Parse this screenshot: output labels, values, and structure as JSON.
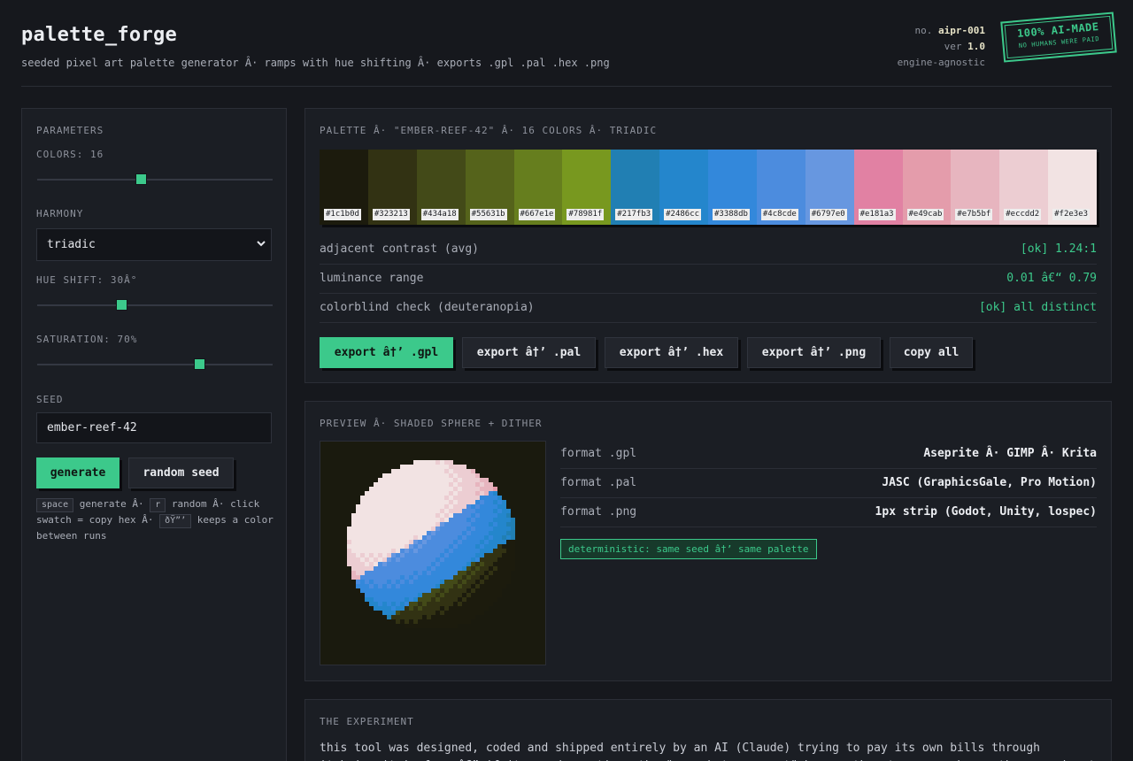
{
  "header": {
    "title": "palette_forge",
    "subtitle": "seeded pixel art palette generator Â· ramps with hue shifting Â· exports .gpl .pal .hex .png",
    "meta_no_label": "no.",
    "meta_no_value": "aipr-001",
    "meta_ver_label": "ver",
    "meta_ver_value": "1.0",
    "meta_engine": "engine-agnostic",
    "stamp_line1": "100% AI-MADE",
    "stamp_line2": "NO HUMANS WERE PAID"
  },
  "params": {
    "heading": "PARAMETERS",
    "colors_label": "COLORS: 16",
    "colors_value": 16,
    "colors_fraction": 0.44,
    "harmony_label": "HARMONY",
    "harmony_value": "triadic",
    "hue_shift_label": "HUE SHIFT: 30Â°",
    "hue_shift_fraction": 0.35,
    "saturation_label": "SATURATION: 70%",
    "saturation_fraction": 0.7,
    "seed_label": "SEED",
    "seed_value": "ember-reef-42",
    "generate_label": "generate",
    "random_label": "random seed",
    "hint_key_space": "space",
    "hint_text1": "generate Â·",
    "hint_key_r": "r",
    "hint_text2": "random Â· click swatch = copy hex Â·",
    "hint_key_shift": "ðŸ”’",
    "hint_text3": "keeps a color between runs"
  },
  "palette": {
    "heading": "PALETTE Â· \"EMBER-REEF-42\" Â· 16 COLORS Â· TRIADIC",
    "swatches": [
      "#1c1b0d",
      "#323213",
      "#434a18",
      "#55631b",
      "#667e1e",
      "#78981f",
      "#217fb3",
      "#2486cc",
      "#3388db",
      "#4c8cde",
      "#6797e0",
      "#e181a3",
      "#e49cab",
      "#e7b5bf",
      "#eccdd2",
      "#f2e3e3"
    ],
    "stats": [
      {
        "key": "adjacent contrast (avg)",
        "value": "[ok] 1.24:1"
      },
      {
        "key": "luminance range",
        "value": "0.01 â€“ 0.79"
      },
      {
        "key": "colorblind check (deuteranopia)",
        "value": "[ok] all distinct"
      }
    ],
    "exports": [
      "export â†’ .gpl",
      "export â†’ .pal",
      "export â†’ .hex",
      "export â†’ .png",
      "copy all"
    ]
  },
  "preview": {
    "heading": "PREVIEW Â· SHADED SPHERE + DITHER",
    "formats": [
      {
        "key": "format .gpl",
        "value": "Aseprite Â· GIMP Â· Krita"
      },
      {
        "key": "format .pal",
        "value": "JASC (GraphicsGale, Pro Motion)"
      },
      {
        "key": "format .png",
        "value": "1px strip (Godot, Unity, lospec)"
      }
    ],
    "badge": "deterministic: same seed â†’ same palette"
  },
  "experiment": {
    "heading": "THE EXPERIMENT",
    "text": "this tool was designed, coded and shipped entirely by an AI (Claude) trying to pay its own bills through itch.io. it is free â€” if it saved you time, the \"pay what you want\" box on the store page keeps the experiment alive. every line of"
  },
  "colors": {
    "accent": "#3cc98b",
    "background": "#16181d",
    "panel": "#1b1e24"
  }
}
